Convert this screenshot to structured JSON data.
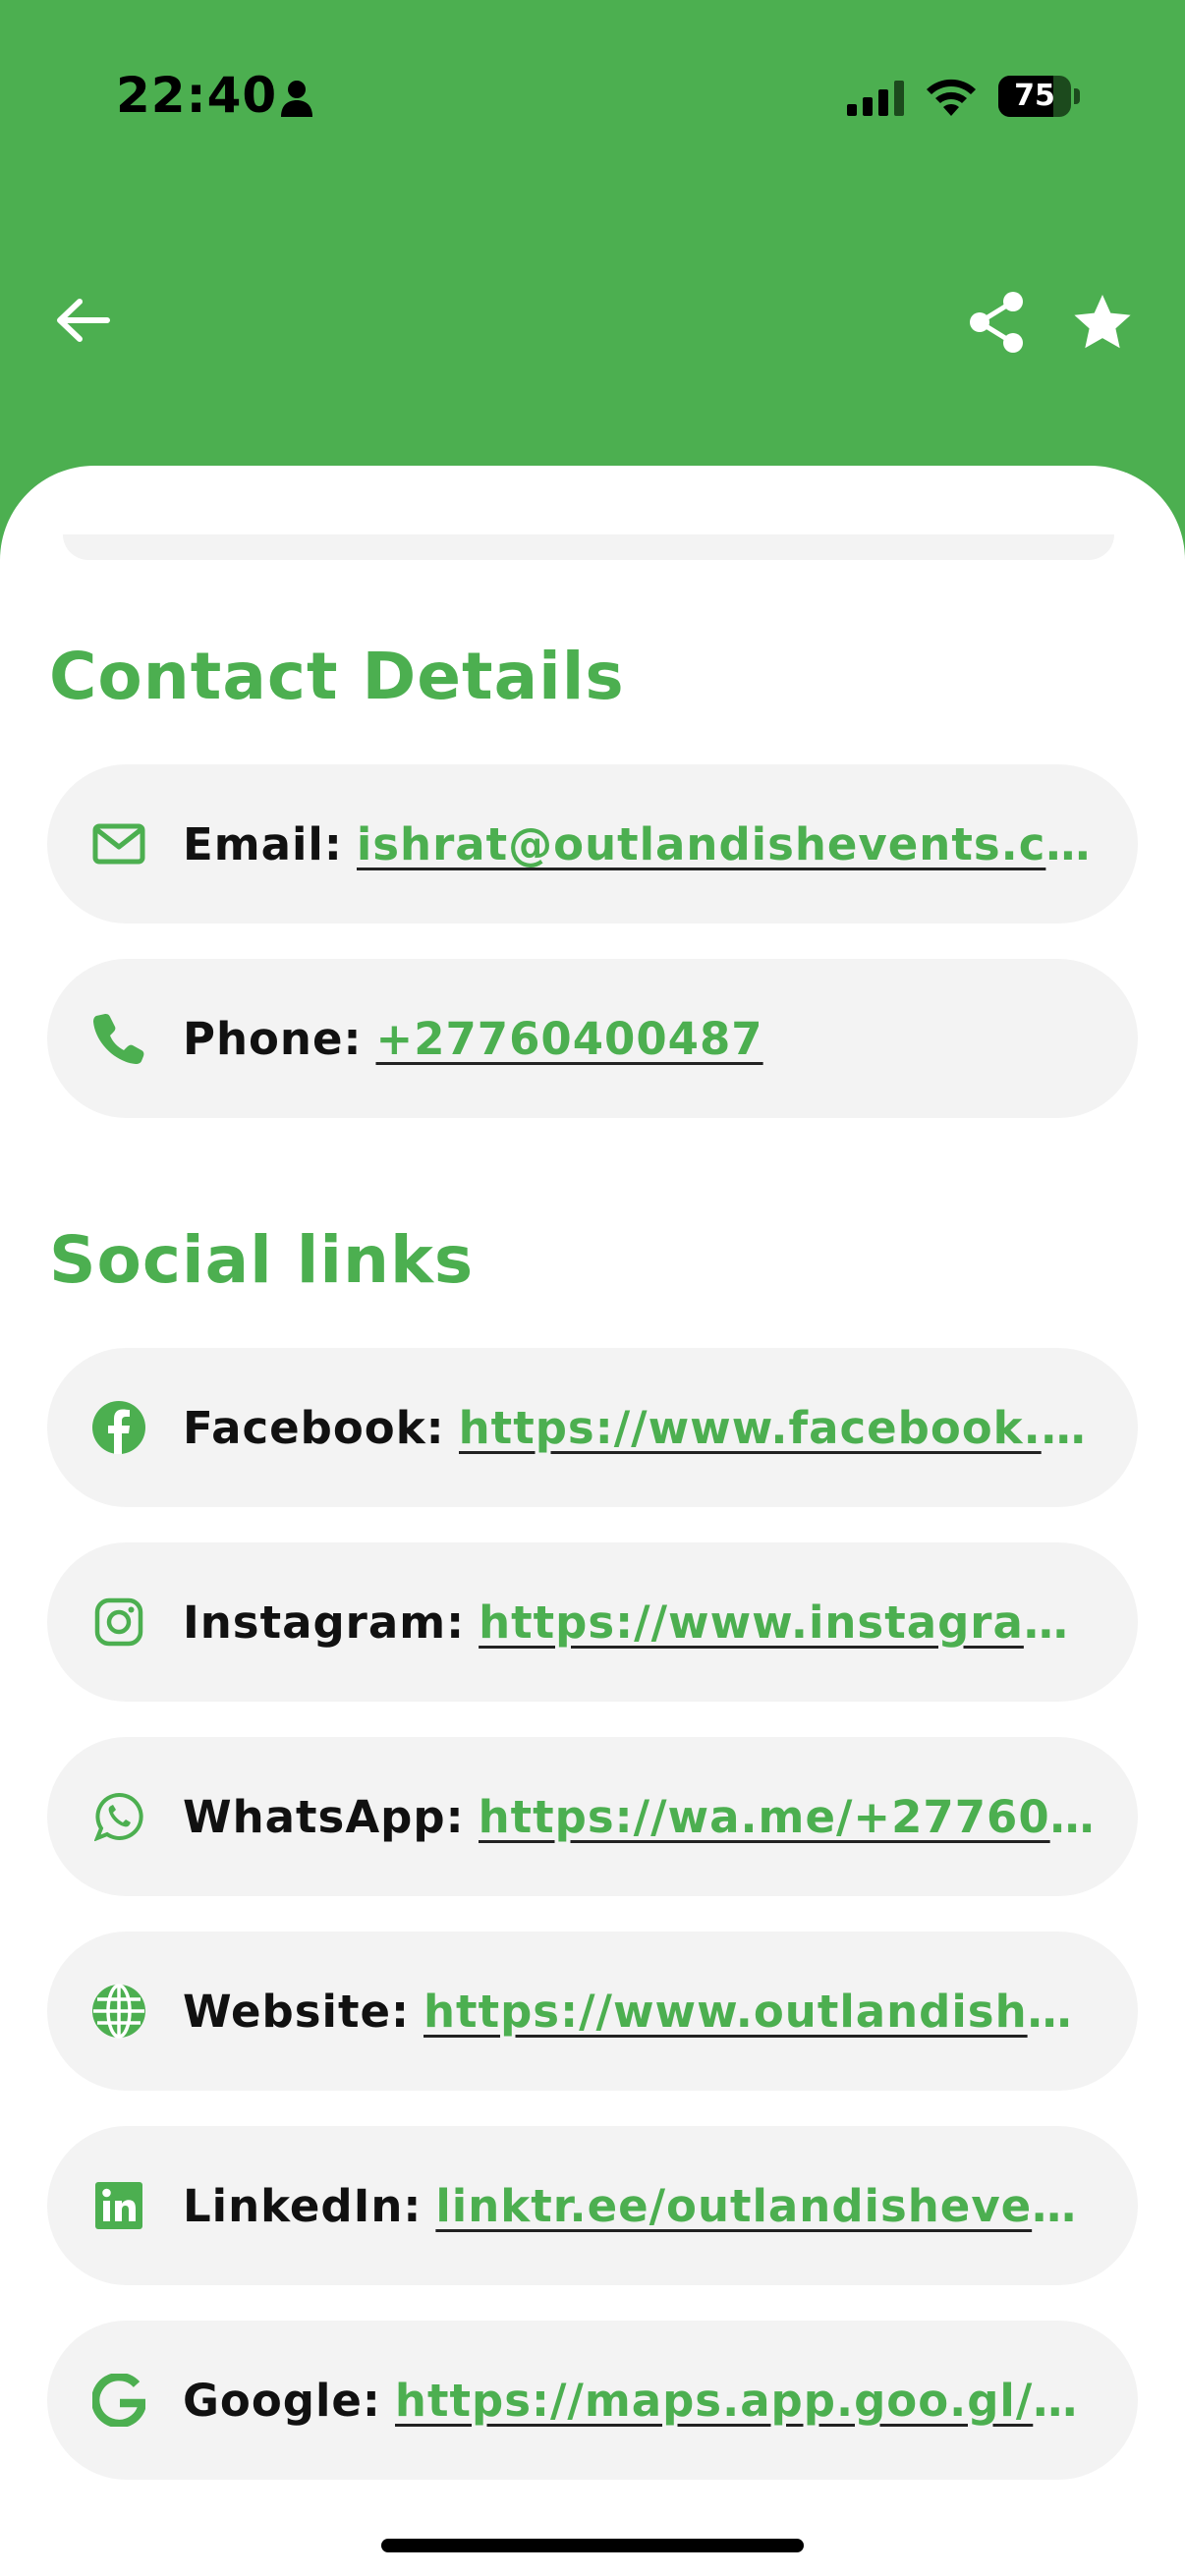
{
  "status_bar": {
    "time": "22:40",
    "battery": "75",
    "battery_level": 0.75,
    "icons": [
      "person-icon",
      "cellular-signal-icon",
      "wifi-icon",
      "battery-icon"
    ]
  },
  "header": {
    "background_color": "#4CAF50",
    "back_icon": "arrow-left-icon",
    "share_icon": "share-icon",
    "favorite_icon": "star-icon"
  },
  "contact": {
    "title": "Contact Details",
    "items": [
      {
        "icon": "envelope-icon",
        "label": "Email:",
        "value": "ishrat@outlandishevents.co..."
      },
      {
        "icon": "phone-icon",
        "label": "Phone:",
        "value": "+27760400487"
      }
    ]
  },
  "social": {
    "title": "Social links",
    "items": [
      {
        "icon": "facebook-icon",
        "label": "Facebook:",
        "value": "https://www.facebook.c..."
      },
      {
        "icon": "instagram-icon",
        "label": "Instagram:",
        "value": "https://www.instagram..."
      },
      {
        "icon": "whatsapp-icon",
        "label": "WhatsApp:",
        "value": "https://wa.me/+27760..."
      },
      {
        "icon": "globe-icon",
        "label": "Website:",
        "value": "https://www.outlandishe..."
      },
      {
        "icon": "linkedin-icon",
        "label": "LinkedIn:",
        "value": "linktr.ee/outlandishevents"
      },
      {
        "icon": "google-icon",
        "label": "Google:",
        "value": "https://maps.app.goo.gl/4..."
      }
    ]
  },
  "colors": {
    "accent": "#4CAF50",
    "card_background": "#F3F3F3",
    "label_text": "#111111"
  }
}
